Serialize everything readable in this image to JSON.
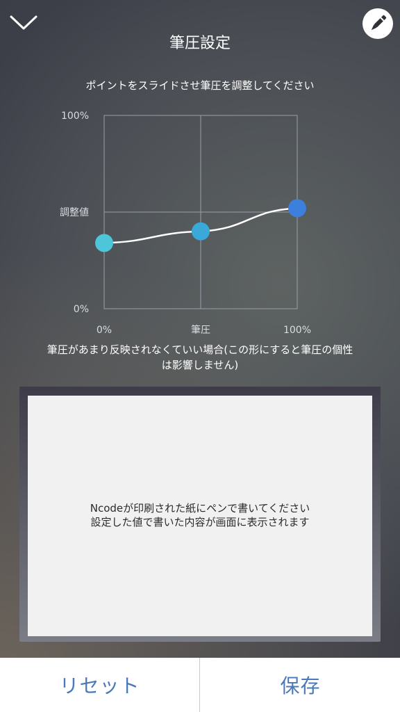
{
  "header": {
    "title": "筆圧設定",
    "close_icon": "chevron-down-icon",
    "pen_icon": "pen-icon"
  },
  "instruction": "ポイントをスライドさせ筆圧を調整してください",
  "chart_data": {
    "type": "line",
    "y_tick_labels": [
      "100%",
      "調整値",
      "0%"
    ],
    "x_tick_labels": [
      "0%",
      "筆圧",
      "100%"
    ],
    "x": [
      0,
      50,
      100
    ],
    "y": [
      34,
      40,
      52
    ],
    "xlim": [
      0,
      100
    ],
    "ylim": [
      0,
      100
    ],
    "adjust_line_y": 50,
    "point_colors": [
      "#4cc6d8",
      "#3aa8d8",
      "#3d7fdc"
    ],
    "grid": true
  },
  "note": {
    "line1": "筆圧があまり反映されなくていい場合(この形にすると筆圧の個性",
    "line2": "は影響しません)"
  },
  "pad": {
    "line1": "Ncodeが印刷された紙にペンで書いてください",
    "line2": "設定した値で書いた内容が画面に表示されます"
  },
  "buttons": {
    "reset": "リセット",
    "save": "保存"
  },
  "colors": {
    "accent": "#4a78b9"
  }
}
